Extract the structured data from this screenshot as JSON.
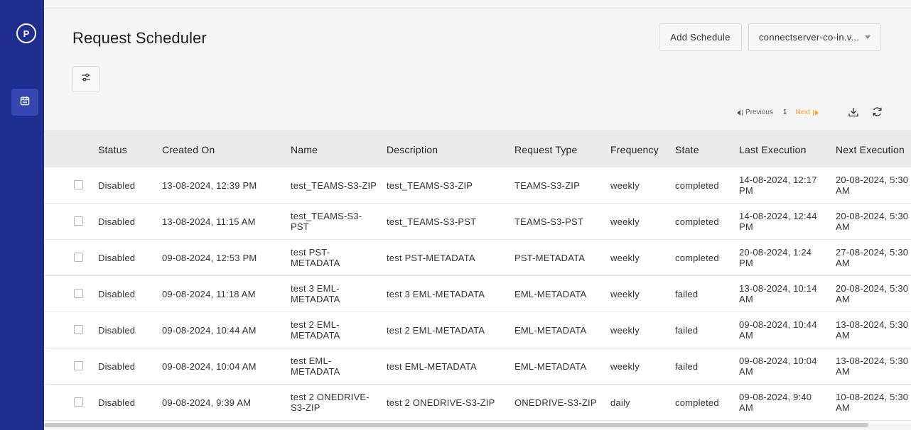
{
  "sidebar": {
    "logo": "P",
    "items": [
      {
        "name": "scheduler",
        "icon": "calendar-icon"
      }
    ]
  },
  "header": {
    "title": "Request Scheduler",
    "add_button": "Add Schedule",
    "server_select": "connectserver-co-in.v..."
  },
  "pagination": {
    "previous": "Previous",
    "page": "1",
    "next": "Next"
  },
  "table": {
    "columns": [
      "Status",
      "Created On",
      "Name",
      "Description",
      "Request Type",
      "Frequency",
      "State",
      "Last Execution",
      "Next Execution"
    ],
    "rows": [
      {
        "status": "Disabled",
        "created_on": "13-08-2024, 12:39 PM",
        "name": "test_TEAMS-S3-ZIP",
        "description": "test_TEAMS-S3-ZIP",
        "request_type": "TEAMS-S3-ZIP",
        "frequency": "weekly",
        "state": "completed",
        "last_execution": "14-08-2024, 12:17\nPM",
        "next_execution": "20-08-2024, 5:30\nAM"
      },
      {
        "status": "Disabled",
        "created_on": "13-08-2024, 11:15 AM",
        "name": "test_TEAMS-S3-\nPST",
        "description": "test_TEAMS-S3-PST",
        "request_type": "TEAMS-S3-PST",
        "frequency": "weekly",
        "state": "completed",
        "last_execution": "14-08-2024, 12:44\nPM",
        "next_execution": "20-08-2024, 5:30\nAM"
      },
      {
        "status": "Disabled",
        "created_on": "09-08-2024, 12:53 PM",
        "name": "test PST-\nMETADATA",
        "description": "test PST-METADATA",
        "request_type": "PST-METADATA",
        "frequency": "weekly",
        "state": "completed",
        "last_execution": "20-08-2024, 1:24\nPM",
        "next_execution": "27-08-2024, 5:30\nAM"
      },
      {
        "status": "Disabled",
        "created_on": "09-08-2024, 11:18 AM",
        "name": "test 3 EML-\nMETADATA",
        "description": "test 3 EML-METADATA",
        "request_type": "EML-METADATA",
        "frequency": "weekly",
        "state": "failed",
        "last_execution": "13-08-2024, 10:14\nAM",
        "next_execution": "20-08-2024, 5:30\nAM"
      },
      {
        "status": "Disabled",
        "created_on": "09-08-2024, 10:44 AM",
        "name": "test 2 EML-\nMETADATA",
        "description": "test 2 EML-METADATA",
        "request_type": "EML-METADATA",
        "frequency": "weekly",
        "state": "failed",
        "last_execution": "09-08-2024, 10:44\nAM",
        "next_execution": "13-08-2024, 5:30\nAM"
      },
      {
        "status": "Disabled",
        "created_on": "09-08-2024, 10:04 AM",
        "name": "test EML-\nMETADATA",
        "description": "test EML-METADATA",
        "request_type": "EML-METADATA",
        "frequency": "weekly",
        "state": "failed",
        "last_execution": "09-08-2024, 10:04\nAM",
        "next_execution": "13-08-2024, 5:30\nAM"
      },
      {
        "status": "Disabled",
        "created_on": "09-08-2024, 9:39 AM",
        "name": "test 2 ONEDRIVE-\nS3-ZIP",
        "description": "test 2 ONEDRIVE-S3-ZIP",
        "request_type": "ONEDRIVE-S3-ZIP",
        "frequency": "daily",
        "state": "completed",
        "last_execution": "09-08-2024, 9:40\nAM",
        "next_execution": "10-08-2024, 5:30\nAM"
      }
    ]
  },
  "colors": {
    "sidebar": "#1f2d8f",
    "nav_active": "#3447b3",
    "accent_next": "#f5a21b"
  }
}
